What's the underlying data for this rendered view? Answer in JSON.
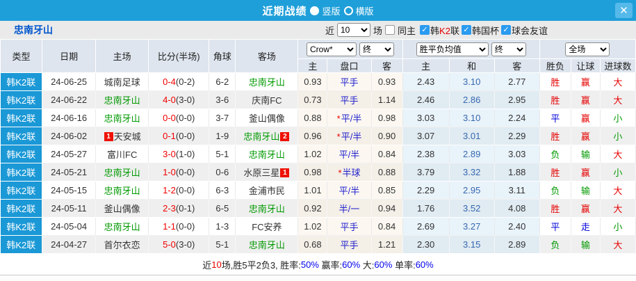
{
  "titlebar": {
    "title": "近期战绩",
    "layout_vertical": "竖版",
    "layout_horizontal": "横版",
    "close_icon": "✕"
  },
  "filter": {
    "team_name": "忠南牙山",
    "near_label": "近",
    "match_count": "10",
    "unit_label": "场",
    "same_home": {
      "label": "同主",
      "checked": false
    },
    "leagues": [
      {
        "parts": [
          {
            "t": "韩",
            "c": "black"
          },
          {
            "t": "K2",
            "c": "red"
          },
          {
            "t": "联",
            "c": "black"
          }
        ],
        "checked": true
      },
      {
        "parts": [
          {
            "t": "韩国杯",
            "c": "black"
          }
        ],
        "checked": true
      },
      {
        "parts": [
          {
            "t": "球会友谊",
            "c": "black"
          }
        ],
        "checked": true
      }
    ]
  },
  "table": {
    "headers": {
      "type": "类型",
      "date": "日期",
      "home": "主场",
      "score": "比分(半场)",
      "corner": "角球",
      "away": "客场",
      "select_crow": "Crow*",
      "select_final1": "终",
      "select_avg": "胜平负均值",
      "select_final2": "终",
      "select_fulltime": "全场",
      "sub": [
        "主",
        "盘口",
        "客",
        "主",
        "和",
        "客",
        "胜负",
        "让球",
        "进球数"
      ]
    },
    "rows": [
      {
        "league": "韩K2联",
        "date": "24-06-25",
        "home": {
          "text": "城南足球",
          "color": "black"
        },
        "score_ft": "0-4",
        "score_ht": "(0-2)",
        "corner": "6-2",
        "away": {
          "text": "忠南牙山",
          "color": "green"
        },
        "odds_home": "0.93",
        "handicap": {
          "star": false,
          "text": "平手"
        },
        "odds_away": "0.93",
        "avg_home": "2.43",
        "avg_draw": "3.10",
        "avg_away": "2.77",
        "result_wdl": {
          "t": "胜",
          "c": "red"
        },
        "result_handicap": {
          "t": "赢",
          "c": "red"
        },
        "result_goals": {
          "t": "大",
          "c": "red"
        }
      },
      {
        "league": "韩K2联",
        "date": "24-06-22",
        "home": {
          "text": "忠南牙山",
          "color": "green"
        },
        "score_ft": "4-0",
        "score_ht": "(3-0)",
        "corner": "3-6",
        "away": {
          "text": "庆南FC",
          "color": "black"
        },
        "odds_home": "0.73",
        "handicap": {
          "star": false,
          "text": "平手"
        },
        "odds_away": "1.14",
        "avg_home": "2.46",
        "avg_draw": "2.86",
        "avg_away": "2.95",
        "result_wdl": {
          "t": "胜",
          "c": "red"
        },
        "result_handicap": {
          "t": "赢",
          "c": "red"
        },
        "result_goals": {
          "t": "大",
          "c": "red"
        }
      },
      {
        "league": "韩K2联",
        "date": "24-06-16",
        "home": {
          "text": "忠南牙山",
          "color": "green"
        },
        "score_ft": "0-0",
        "score_ht": "(0-0)",
        "corner": "3-7",
        "away": {
          "text": "釜山偶像",
          "color": "black"
        },
        "odds_home": "0.88",
        "handicap": {
          "star": true,
          "text": "平/半"
        },
        "odds_away": "0.98",
        "avg_home": "3.03",
        "avg_draw": "3.10",
        "avg_away": "2.24",
        "result_wdl": {
          "t": "平",
          "c": "blue"
        },
        "result_handicap": {
          "t": "赢",
          "c": "red"
        },
        "result_goals": {
          "t": "小",
          "c": "green"
        }
      },
      {
        "league": "韩K2联",
        "date": "24-06-02",
        "home": {
          "text": "天安城",
          "color": "black",
          "badge_before": "1"
        },
        "score_ft": "0-1",
        "score_ht": "(0-0)",
        "corner": "1-9",
        "away": {
          "text": "忠南牙山",
          "color": "green",
          "badge_after": "2"
        },
        "odds_home": "0.96",
        "handicap": {
          "star": true,
          "text": "平/半"
        },
        "odds_away": "0.90",
        "avg_home": "3.07",
        "avg_draw": "3.01",
        "avg_away": "2.29",
        "result_wdl": {
          "t": "胜",
          "c": "red"
        },
        "result_handicap": {
          "t": "赢",
          "c": "red"
        },
        "result_goals": {
          "t": "小",
          "c": "green"
        }
      },
      {
        "league": "韩K2联",
        "date": "24-05-27",
        "home": {
          "text": "富川FC",
          "color": "black"
        },
        "score_ft": "3-0",
        "score_ht": "(1-0)",
        "corner": "5-1",
        "away": {
          "text": "忠南牙山",
          "color": "green"
        },
        "odds_home": "1.02",
        "handicap": {
          "star": false,
          "text": "平/半"
        },
        "odds_away": "0.84",
        "avg_home": "2.38",
        "avg_draw": "2.89",
        "avg_away": "3.03",
        "result_wdl": {
          "t": "负",
          "c": "green"
        },
        "result_handicap": {
          "t": "输",
          "c": "green"
        },
        "result_goals": {
          "t": "大",
          "c": "red"
        }
      },
      {
        "league": "韩K2联",
        "date": "24-05-21",
        "home": {
          "text": "忠南牙山",
          "color": "green"
        },
        "score_ft": "1-0",
        "score_ht": "(0-0)",
        "corner": "0-6",
        "away": {
          "text": "水原三星",
          "color": "black",
          "badge_after": "1"
        },
        "odds_home": "0.98",
        "handicap": {
          "star": true,
          "text": "半球"
        },
        "odds_away": "0.88",
        "avg_home": "3.79",
        "avg_draw": "3.32",
        "avg_away": "1.88",
        "result_wdl": {
          "t": "胜",
          "c": "red"
        },
        "result_handicap": {
          "t": "赢",
          "c": "red"
        },
        "result_goals": {
          "t": "小",
          "c": "green"
        }
      },
      {
        "league": "韩K2联",
        "date": "24-05-15",
        "home": {
          "text": "忠南牙山",
          "color": "green"
        },
        "score_ft": "1-2",
        "score_ht": "(0-0)",
        "corner": "6-3",
        "away": {
          "text": "金浦市民",
          "color": "black"
        },
        "odds_home": "1.01",
        "handicap": {
          "star": false,
          "text": "平/半"
        },
        "odds_away": "0.85",
        "avg_home": "2.29",
        "avg_draw": "2.95",
        "avg_away": "3.11",
        "result_wdl": {
          "t": "负",
          "c": "green"
        },
        "result_handicap": {
          "t": "输",
          "c": "green"
        },
        "result_goals": {
          "t": "大",
          "c": "red"
        }
      },
      {
        "league": "韩K2联",
        "date": "24-05-11",
        "home": {
          "text": "釜山偶像",
          "color": "black"
        },
        "score_ft": "2-3",
        "score_ht": "(0-1)",
        "corner": "6-5",
        "away": {
          "text": "忠南牙山",
          "color": "green"
        },
        "odds_home": "0.92",
        "handicap": {
          "star": false,
          "text": "半/一"
        },
        "odds_away": "0.94",
        "avg_home": "1.76",
        "avg_draw": "3.52",
        "avg_away": "4.08",
        "result_wdl": {
          "t": "胜",
          "c": "red"
        },
        "result_handicap": {
          "t": "赢",
          "c": "red"
        },
        "result_goals": {
          "t": "大",
          "c": "red"
        }
      },
      {
        "league": "韩K2联",
        "date": "24-05-04",
        "home": {
          "text": "忠南牙山",
          "color": "green"
        },
        "score_ft": "1-1",
        "score_ht": "(0-0)",
        "corner": "1-3",
        "away": {
          "text": "FC安养",
          "color": "black"
        },
        "odds_home": "1.02",
        "handicap": {
          "star": false,
          "text": "平手"
        },
        "odds_away": "0.84",
        "avg_home": "2.69",
        "avg_draw": "3.27",
        "avg_away": "2.40",
        "result_wdl": {
          "t": "平",
          "c": "blue"
        },
        "result_handicap": {
          "t": "走",
          "c": "blue"
        },
        "result_goals": {
          "t": "小",
          "c": "green"
        }
      },
      {
        "league": "韩K2联",
        "date": "24-04-27",
        "home": {
          "text": "首尔衣恋",
          "color": "black"
        },
        "score_ft": "5-0",
        "score_ht": "(3-0)",
        "corner": "5-1",
        "away": {
          "text": "忠南牙山",
          "color": "green"
        },
        "odds_home": "0.68",
        "handicap": {
          "star": false,
          "text": "平手"
        },
        "odds_away": "1.21",
        "avg_home": "2.30",
        "avg_draw": "3.15",
        "avg_away": "2.89",
        "result_wdl": {
          "t": "负",
          "c": "green"
        },
        "result_handicap": {
          "t": "输",
          "c": "green"
        },
        "result_goals": {
          "t": "大",
          "c": "red"
        }
      }
    ]
  },
  "footer": {
    "segments": [
      {
        "t": "近",
        "c": "black"
      },
      {
        "t": "10",
        "c": "red"
      },
      {
        "t": "场,胜5平2负3, 胜率:",
        "c": "black"
      },
      {
        "t": "50%",
        "c": "blue"
      },
      {
        "t": " 赢率:",
        "c": "black"
      },
      {
        "t": "60%",
        "c": "blue"
      },
      {
        "t": " 大:",
        "c": "black"
      },
      {
        "t": "60%",
        "c": "blue"
      },
      {
        "t": " 单率:",
        "c": "black"
      },
      {
        "t": "60%",
        "c": "blue"
      }
    ]
  }
}
